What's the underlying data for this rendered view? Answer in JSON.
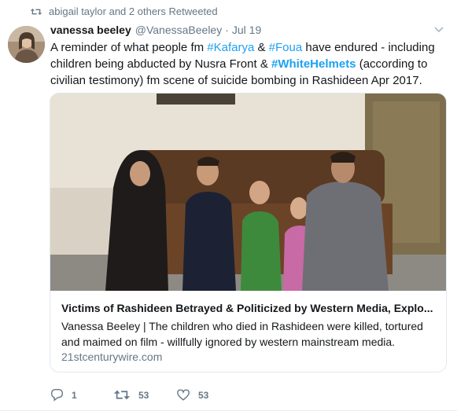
{
  "retweet_context": "abigail taylor and 2 others Retweeted",
  "author": {
    "name": "vanessa beeley",
    "handle": "@VanessaBeeley",
    "separator": "·",
    "time": "Jul 19"
  },
  "tweet": {
    "t1": "A reminder of what people fm ",
    "h1": "#Kafarya",
    "t2": " & ",
    "h2": "#Foua",
    "t3": " have endured - including children being abducted by Nusra Front & ",
    "h3": "#WhiteHelmets",
    "t4": " (according to civilian testimony) fm scene of suicide bombing in Rashideen Apr 2017."
  },
  "card": {
    "title": "Victims of Rashideen Betrayed & Politicized by Western Media, Explo...",
    "description": "Vanessa Beeley | The children who died in Rashideen were killed, tortured and maimed on film - willfully ignored by western mainstream media.",
    "domain": "21stcenturywire.com"
  },
  "actions": {
    "reply_count": "1",
    "retweet_count": "53",
    "like_count": "53"
  },
  "colors": {
    "link": "#1da1f2",
    "muted": "#657786",
    "retweet_active": "#17bf63"
  }
}
